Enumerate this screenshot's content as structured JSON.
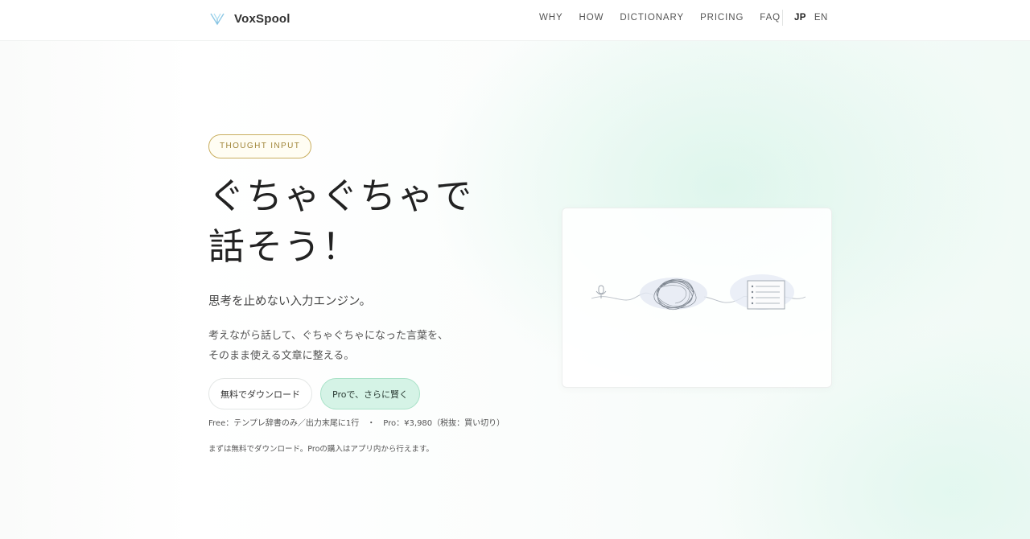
{
  "brand": {
    "name": "VoxSpool"
  },
  "nav": {
    "items": [
      {
        "label": "WHY"
      },
      {
        "label": "HOW"
      },
      {
        "label": "DICTIONARY"
      },
      {
        "label": "PRICING"
      },
      {
        "label": "FAQ"
      }
    ],
    "languages": [
      {
        "label": "JP",
        "active": true
      },
      {
        "label": "EN",
        "active": false
      }
    ]
  },
  "hero": {
    "badge": "THOUGHT INPUT",
    "title_line1": "ぐちゃぐちゃで",
    "title_line2": "話そう！",
    "subtitle": "思考を止めない入力エンジン。",
    "description_line1": "考えながら話して、ぐちゃぐちゃになった言葉を、",
    "description_line2": "そのまま使える文章に整える。",
    "download_button": "無料でダウンロード",
    "pro_button": "Proで、さらに賢く",
    "pricing_free": "Free：テンプレ辞書のみ／出力末尾に1行",
    "pricing_separator": "・",
    "pricing_pro": "Pro：¥3,980（税抜：買い切り）",
    "note": "まずは無料でダウンロード。Proの購入はアプリ内から行えます。"
  },
  "illustration": {
    "icons": [
      "microphone-icon",
      "tangle-icon",
      "document-list-icon"
    ],
    "accent_color": "#dde6f2"
  },
  "colors": {
    "badge_border": "#c9ae5f",
    "badge_text": "#9f8437",
    "pro_button_bg": "#d5f3e6",
    "pro_button_border": "#a9e2c8"
  }
}
